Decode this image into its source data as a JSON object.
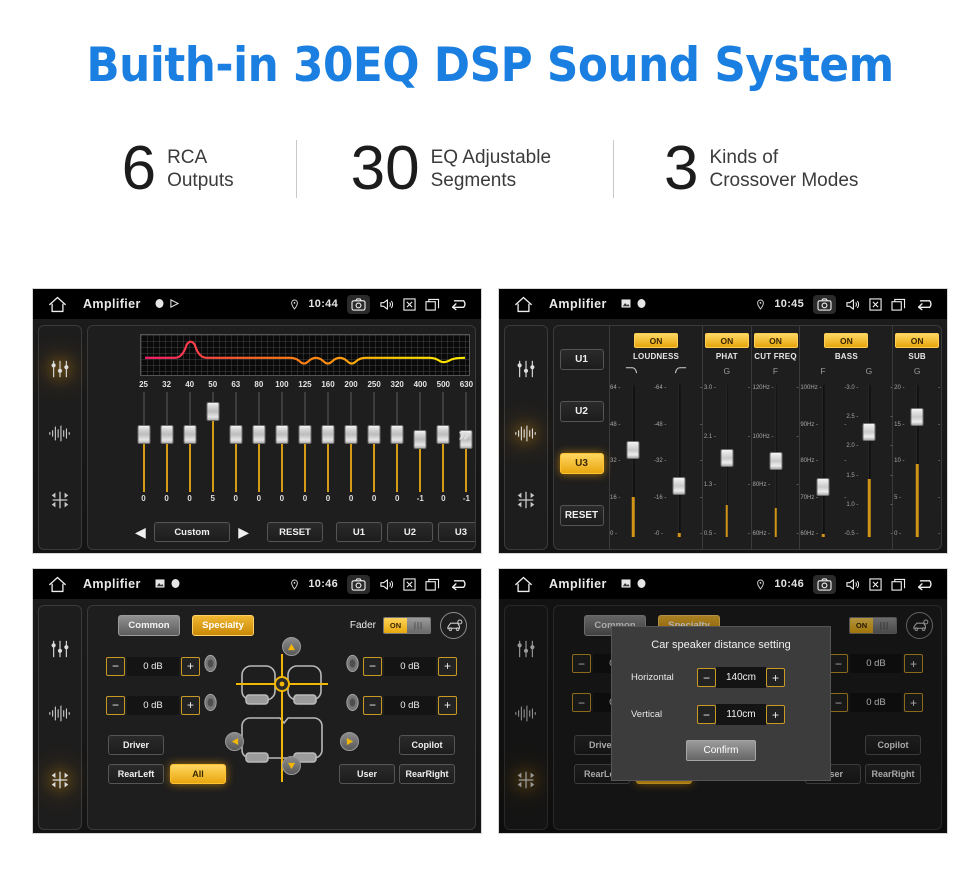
{
  "headline": "Buith-in 30EQ DSP Sound System",
  "accent_color": "#1a7fe0",
  "stats": [
    {
      "number": "6",
      "line1": "RCA",
      "line2": "Outputs"
    },
    {
      "number": "30",
      "line1": "EQ Adjustable",
      "line2": "Segments"
    },
    {
      "number": "3",
      "line1": "Kinds of",
      "line2": "Crossover Modes"
    }
  ],
  "panels": {
    "eq": {
      "statusbar": {
        "title": "Amplifier",
        "time": "10:44",
        "icons": [
          "home-icon",
          "record-icon",
          "play-icon",
          "location-pin-icon",
          "camera-icon",
          "volume-icon",
          "close-box-icon",
          "recent-apps-icon",
          "back-arrow-icon"
        ]
      },
      "rail": [
        "equalizer-icon",
        "waveform-icon",
        "balance-icon"
      ],
      "rail_active": 0,
      "frequencies": [
        "25",
        "32",
        "40",
        "50",
        "63",
        "80",
        "100",
        "125",
        "160",
        "200",
        "250",
        "320",
        "400",
        "500",
        "630"
      ],
      "values": [
        "0",
        "0",
        "0",
        "5",
        "0",
        "0",
        "0",
        "0",
        "0",
        "0",
        "0",
        "0",
        "-1",
        "0",
        "-1"
      ],
      "preset": "Custom",
      "reset_label": "RESET",
      "user_presets": [
        "U1",
        "U2",
        "U3"
      ],
      "expand_label": "»"
    },
    "crossover": {
      "statusbar": {
        "title": "Amplifier",
        "time": "10:45"
      },
      "rail_active": 1,
      "presets": [
        "U1",
        "U2",
        "U3"
      ],
      "active_preset": "U3",
      "reset_label": "RESET",
      "sections": [
        {
          "name": "LOUDNESS",
          "state": "ON",
          "header_icons": "curve-icons",
          "sliders": [
            {
              "axis": "",
              "ticks": [
                "64",
                "48",
                "32",
                "16",
                "0"
              ],
              "pos": 0.42
            },
            {
              "axis": "",
              "ticks": [
                "64",
                "48",
                "32",
                "16",
                "0"
              ],
              "pos": 0.04
            }
          ]
        },
        {
          "name": "PHAT",
          "state": "ON",
          "sliders": [
            {
              "axis": "G",
              "ticks": [
                "3.0",
                "2.1",
                "1.3",
                "0.5"
              ],
              "pos": 0.33
            }
          ]
        },
        {
          "name": "CUT FREQ",
          "state": "ON",
          "sliders": [
            {
              "axis": "F",
              "ticks": [
                "120Hz",
                "100Hz",
                "80Hz",
                "60Hz"
              ],
              "pos": 0.3
            }
          ]
        },
        {
          "name": "BASS",
          "state": "ON",
          "sliders": [
            {
              "axis": "F",
              "ticks": [
                "100Hz",
                "90Hz",
                "80Hz",
                "70Hz",
                "60Hz"
              ],
              "pos": 0.03
            },
            {
              "axis": "G",
              "ticks": [
                "3.0",
                "2.5",
                "2.0",
                "1.5",
                "1.0",
                "0.5"
              ],
              "pos": 0.6
            }
          ]
        },
        {
          "name": "SUB",
          "state": "ON",
          "sliders": [
            {
              "axis": "G",
              "ticks": [
                "20",
                "15",
                "10",
                "5",
                "0"
              ],
              "pos": 0.76
            }
          ]
        }
      ]
    },
    "fader": {
      "statusbar": {
        "title": "Amplifier",
        "time": "10:46"
      },
      "rail_active": 2,
      "tabs": [
        "Common",
        "Specialty"
      ],
      "active_tab": "Specialty",
      "fader_label": "Fader",
      "fader_state": "ON",
      "car_setting_icon": "car-speaker-icon",
      "levels": [
        {
          "position": "front-left",
          "value": "0 dB"
        },
        {
          "position": "rear-left",
          "value": "0 dB"
        },
        {
          "position": "front-right",
          "value": "0 dB"
        },
        {
          "position": "rear-right",
          "value": "0 dB"
        }
      ],
      "minus_label": "−",
      "plus_label": "+",
      "seat_buttons_left": [
        "Driver",
        "RearLeft"
      ],
      "seat_buttons_right": [
        "Copilot",
        "RearRight"
      ],
      "center_buttons": [
        "All",
        "User"
      ],
      "active_center": "All"
    },
    "dialog_panel": {
      "statusbar": {
        "title": "Amplifier",
        "time": "10:46"
      },
      "rail_active": 2,
      "tabs": [
        "Common",
        "Specialty"
      ],
      "active_tab": "Specialty",
      "fader_state": "ON",
      "dialog": {
        "title": "Car speaker distance setting",
        "rows": [
          {
            "label": "Horizontal",
            "value": "140cm"
          },
          {
            "label": "Vertical",
            "value": "110cm"
          }
        ],
        "confirm_label": "Confirm",
        "minus_label": "−",
        "plus_label": "+"
      },
      "seat_buttons_left": [
        "Driver",
        "RearLef."
      ],
      "seat_buttons_right": [
        "Copilot",
        "RearRight"
      ],
      "center_buttons": [
        "All",
        "User"
      ]
    }
  }
}
